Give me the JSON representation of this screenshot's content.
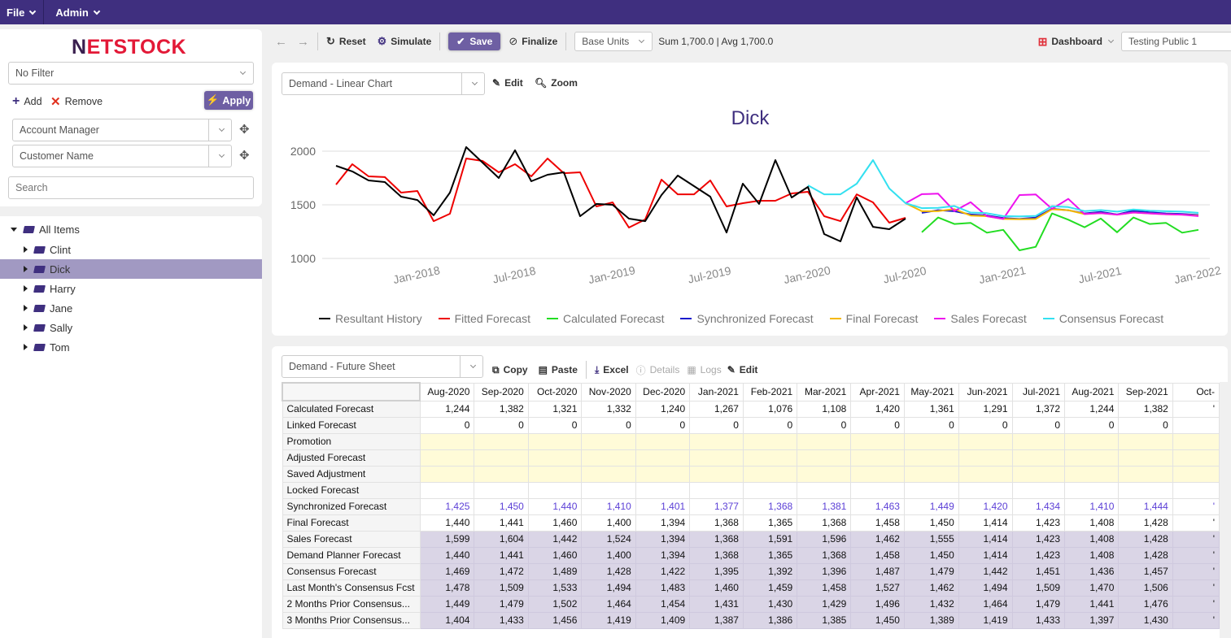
{
  "topbar": {
    "menus": [
      {
        "label": "File"
      },
      {
        "label": "Admin"
      }
    ]
  },
  "sidebar": {
    "logo": {
      "n": "N",
      "rest": "ETSTOCK"
    },
    "filter": {
      "value": "No Filter"
    },
    "add_label": "Add",
    "remove_label": "Remove",
    "apply_label": "Apply",
    "groupings": [
      {
        "value": "Account Manager"
      },
      {
        "value": "Customer Name"
      }
    ],
    "search": {
      "placeholder": "Search",
      "value": ""
    },
    "tree": {
      "root": "All Items",
      "children": [
        {
          "label": "Clint",
          "selected": false
        },
        {
          "label": "Dick",
          "selected": true
        },
        {
          "label": "Harry",
          "selected": false
        },
        {
          "label": "Jane",
          "selected": false
        },
        {
          "label": "Sally",
          "selected": false
        },
        {
          "label": "Tom",
          "selected": false
        }
      ]
    }
  },
  "toolbar": {
    "reset_label": "Reset",
    "simulate_label": "Simulate",
    "save_label": "Save",
    "finalize_label": "Finalize",
    "units": {
      "value": "Base Units"
    },
    "summary": "Sum 1,700.0 | Avg 1,700.0",
    "dashboard_label": "Dashboard",
    "dashboard_name": {
      "value": "Testing Public 1"
    }
  },
  "chart_panel": {
    "selector": {
      "value": "Demand - Linear Chart"
    },
    "edit_label": "Edit",
    "zoom_label": "Zoom"
  },
  "chart_data": {
    "type": "line",
    "title": "Dick",
    "xlabel": "",
    "ylabel": "",
    "ylim": [
      1000,
      2000
    ],
    "yticks": [
      1000,
      1500,
      2000
    ],
    "grid": true,
    "legend_position": "bottom",
    "x_start": "Aug-2017",
    "x_end": "Jan-2022",
    "xticks": [
      "Jan-2018",
      "Jul-2018",
      "Jan-2019",
      "Jul-2019",
      "Jan-2020",
      "Jul-2020",
      "Jan-2021",
      "Jul-2021",
      "Jan-2022"
    ],
    "series": [
      {
        "name": "Resultant History",
        "color": "#000000",
        "start": "Aug-2017",
        "values": [
          1864,
          1811,
          1727,
          1712,
          1576,
          1545,
          1402,
          1614,
          2038,
          1894,
          1750,
          2008,
          1720,
          1780,
          1803,
          1394,
          1508,
          1500,
          1371,
          1348,
          1591,
          1773,
          1674,
          1576,
          1242,
          1697,
          1508,
          1917,
          1568,
          1667,
          1227,
          1159,
          1568,
          1295,
          1273,
          1371
        ]
      },
      {
        "name": "Fitted Forecast",
        "color": "#ee0000",
        "start": "Aug-2017",
        "values": [
          1689,
          1879,
          1765,
          1758,
          1614,
          1629,
          1348,
          1417,
          1932,
          1909,
          1803,
          1879,
          1765,
          1932,
          1795,
          1803,
          1485,
          1523,
          1288,
          1364,
          1735,
          1598,
          1598,
          1727,
          1485,
          1515,
          1538,
          1538,
          1606,
          1621,
          1394,
          1348,
          1598,
          1523,
          1333,
          1379
        ]
      },
      {
        "name": "Calculated Forecast",
        "color": "#22dd22",
        "start": "Aug-2020",
        "values": [
          1244,
          1382,
          1321,
          1332,
          1240,
          1267,
          1076,
          1108,
          1420,
          1361,
          1291,
          1372,
          1244,
          1382,
          1321,
          1332,
          1240,
          1267
        ]
      },
      {
        "name": "Synchronized Forecast",
        "color": "#1a1acc",
        "start": "Aug-2020",
        "values": [
          1425,
          1450,
          1440,
          1410,
          1401,
          1377,
          1368,
          1381,
          1463,
          1449,
          1420,
          1434,
          1410,
          1444,
          1430,
          1420,
          1415,
          1405
        ]
      },
      {
        "name": "Final Forecast",
        "color": "#f5b800",
        "start": "Jul-2020",
        "values": [
          1515,
          1440,
          1441,
          1460,
          1400,
          1394,
          1368,
          1365,
          1368,
          1458,
          1450,
          1414,
          1423,
          1408,
          1428,
          1420,
          1412,
          1408,
          1400
        ]
      },
      {
        "name": "Sales Forecast",
        "color": "#ee11ee",
        "start": "Jul-2020",
        "values": [
          1515,
          1599,
          1604,
          1442,
          1524,
          1394,
          1368,
          1591,
          1596,
          1462,
          1555,
          1414,
          1423,
          1408,
          1428,
          1420,
          1412,
          1408,
          1395
        ]
      },
      {
        "name": "Consensus Forecast",
        "color": "#33e0f0",
        "start": "Jan-2020",
        "values": [
          1682,
          1598,
          1598,
          1697,
          1917,
          1652,
          1515,
          1469,
          1472,
          1489,
          1428,
          1422,
          1395,
          1392,
          1396,
          1487,
          1479,
          1442,
          1451,
          1436,
          1457,
          1445,
          1440,
          1436,
          1425
        ]
      }
    ]
  },
  "sheet_panel": {
    "selector": {
      "value": "Demand - Future Sheet"
    },
    "copy_label": "Copy",
    "paste_label": "Paste",
    "excel_label": "Excel",
    "details_label": "Details",
    "logs_label": "Logs",
    "edit_label": "Edit",
    "columns": [
      "Aug-2020",
      "Sep-2020",
      "Oct-2020",
      "Nov-2020",
      "Dec-2020",
      "Jan-2021",
      "Feb-2021",
      "Mar-2021",
      "Apr-2021",
      "May-2021",
      "Jun-2021",
      "Jul-2021",
      "Aug-2021",
      "Sep-2021",
      "Oct-"
    ],
    "rows": [
      {
        "label": "Calculated Forecast",
        "style": "",
        "values": [
          "1,244",
          "1,382",
          "1,321",
          "1,332",
          "1,240",
          "1,267",
          "1,076",
          "1,108",
          "1,420",
          "1,361",
          "1,291",
          "1,372",
          "1,244",
          "1,382",
          "'"
        ]
      },
      {
        "label": "Linked Forecast",
        "style": "",
        "values": [
          "0",
          "0",
          "0",
          "0",
          "0",
          "0",
          "0",
          "0",
          "0",
          "0",
          "0",
          "0",
          "0",
          "0",
          ""
        ]
      },
      {
        "label": "Promotion",
        "style": "yellow",
        "values": [
          "",
          "",
          "",
          "",
          "",
          "",
          "",
          "",
          "",
          "",
          "",
          "",
          "",
          "",
          ""
        ]
      },
      {
        "label": "Adjusted Forecast",
        "style": "yellow",
        "values": [
          "",
          "",
          "",
          "",
          "",
          "",
          "",
          "",
          "",
          "",
          "",
          "",
          "",
          "",
          ""
        ]
      },
      {
        "label": "Saved Adjustment",
        "style": "yellow",
        "values": [
          "",
          "",
          "",
          "",
          "",
          "",
          "",
          "",
          "",
          "",
          "",
          "",
          "",
          "",
          ""
        ]
      },
      {
        "label": "Locked Forecast",
        "style": "",
        "values": [
          "",
          "",
          "",
          "",
          "",
          "",
          "",
          "",
          "",
          "",
          "",
          "",
          "",
          "",
          ""
        ]
      },
      {
        "label": "Synchronized Forecast",
        "style": "blue",
        "values": [
          "1,425",
          "1,450",
          "1,440",
          "1,410",
          "1,401",
          "1,377",
          "1,368",
          "1,381",
          "1,463",
          "1,449",
          "1,420",
          "1,434",
          "1,410",
          "1,444",
          "'"
        ]
      },
      {
        "label": "Final Forecast",
        "style": "",
        "values": [
          "1,440",
          "1,441",
          "1,460",
          "1,400",
          "1,394",
          "1,368",
          "1,365",
          "1,368",
          "1,458",
          "1,450",
          "1,414",
          "1,423",
          "1,408",
          "1,428",
          "'"
        ]
      },
      {
        "label": "Sales Forecast",
        "style": "purple",
        "values": [
          "1,599",
          "1,604",
          "1,442",
          "1,524",
          "1,394",
          "1,368",
          "1,591",
          "1,596",
          "1,462",
          "1,555",
          "1,414",
          "1,423",
          "1,408",
          "1,428",
          "'"
        ]
      },
      {
        "label": "Demand Planner Forecast",
        "style": "purple",
        "values": [
          "1,440",
          "1,441",
          "1,460",
          "1,400",
          "1,394",
          "1,368",
          "1,365",
          "1,368",
          "1,458",
          "1,450",
          "1,414",
          "1,423",
          "1,408",
          "1,428",
          "'"
        ]
      },
      {
        "label": "Consensus Forecast",
        "style": "purple",
        "values": [
          "1,469",
          "1,472",
          "1,489",
          "1,428",
          "1,422",
          "1,395",
          "1,392",
          "1,396",
          "1,487",
          "1,479",
          "1,442",
          "1,451",
          "1,436",
          "1,457",
          "'"
        ]
      },
      {
        "label": "Last Month's Consensus Fcst",
        "style": "purple",
        "values": [
          "1,478",
          "1,509",
          "1,533",
          "1,494",
          "1,483",
          "1,460",
          "1,459",
          "1,458",
          "1,527",
          "1,462",
          "1,494",
          "1,509",
          "1,470",
          "1,506",
          "'"
        ]
      },
      {
        "label": "2 Months Prior Consensus...",
        "style": "purple",
        "values": [
          "1,449",
          "1,479",
          "1,502",
          "1,464",
          "1,454",
          "1,431",
          "1,430",
          "1,429",
          "1,496",
          "1,432",
          "1,464",
          "1,479",
          "1,441",
          "1,476",
          "'"
        ]
      },
      {
        "label": "3 Months Prior Consensus...",
        "style": "purple",
        "values": [
          "1,404",
          "1,433",
          "1,456",
          "1,419",
          "1,409",
          "1,387",
          "1,386",
          "1,385",
          "1,450",
          "1,389",
          "1,419",
          "1,433",
          "1,397",
          "1,430",
          "'"
        ]
      }
    ]
  }
}
